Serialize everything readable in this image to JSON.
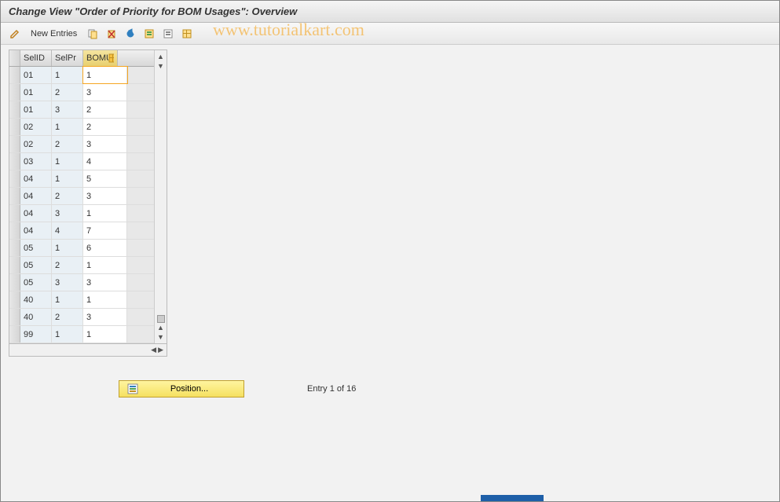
{
  "title": "Change View \"Order of Priority for BOM Usages\": Overview",
  "watermark": "www.tutorialkart.com",
  "toolbar": {
    "new_entries_label": "New Entries"
  },
  "table": {
    "headers": {
      "selid": "SelID",
      "selpr": "SelPr",
      "bomusg": "BOMUsg"
    },
    "rows": [
      {
        "selid": "01",
        "selpr": "1",
        "bomusg": "1",
        "selected": true
      },
      {
        "selid": "01",
        "selpr": "2",
        "bomusg": "3"
      },
      {
        "selid": "01",
        "selpr": "3",
        "bomusg": "2"
      },
      {
        "selid": "02",
        "selpr": "1",
        "bomusg": "2"
      },
      {
        "selid": "02",
        "selpr": "2",
        "bomusg": "3"
      },
      {
        "selid": "03",
        "selpr": "1",
        "bomusg": "4"
      },
      {
        "selid": "04",
        "selpr": "1",
        "bomusg": "5"
      },
      {
        "selid": "04",
        "selpr": "2",
        "bomusg": "3"
      },
      {
        "selid": "04",
        "selpr": "3",
        "bomusg": "1"
      },
      {
        "selid": "04",
        "selpr": "4",
        "bomusg": "7"
      },
      {
        "selid": "05",
        "selpr": "1",
        "bomusg": "6"
      },
      {
        "selid": "05",
        "selpr": "2",
        "bomusg": "1"
      },
      {
        "selid": "05",
        "selpr": "3",
        "bomusg": "3"
      },
      {
        "selid": "40",
        "selpr": "1",
        "bomusg": "1"
      },
      {
        "selid": "40",
        "selpr": "2",
        "bomusg": "3"
      },
      {
        "selid": "99",
        "selpr": "1",
        "bomusg": "1"
      }
    ]
  },
  "position_button_label": "Position...",
  "entry_status": "Entry 1 of 16"
}
